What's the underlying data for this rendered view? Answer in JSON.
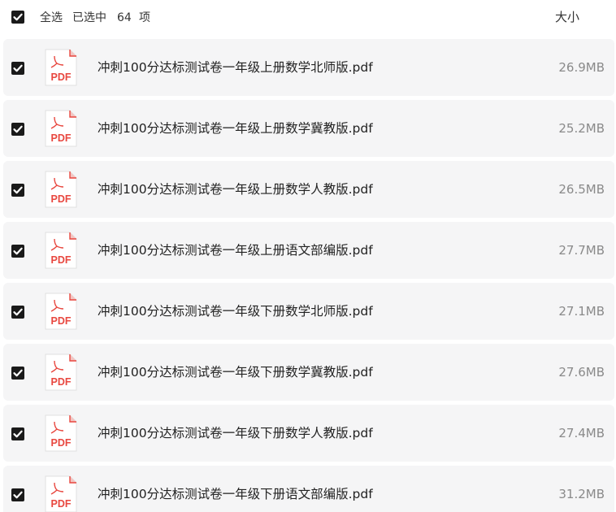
{
  "header": {
    "select_all_label": "全选",
    "selected_prefix": "已选中",
    "selected_count": "64",
    "selected_suffix": "项",
    "size_column_label": "大小"
  },
  "colors": {
    "checkbox": "#1a1a1a",
    "row_background": "#f5f5f6",
    "pdf_icon_accent": "#e8473f",
    "size_text": "#8a8a8a"
  },
  "files": [
    {
      "name": "冲刺100分达标测试卷一年级上册数学北师版.pdf",
      "size": "26.9MB",
      "icon": "pdf-file-icon",
      "checked": true
    },
    {
      "name": "冲刺100分达标测试卷一年级上册数学冀教版.pdf",
      "size": "25.2MB",
      "icon": "pdf-file-icon",
      "checked": true
    },
    {
      "name": "冲刺100分达标测试卷一年级上册数学人教版.pdf",
      "size": "26.5MB",
      "icon": "pdf-file-icon",
      "checked": true
    },
    {
      "name": "冲刺100分达标测试卷一年级上册语文部编版.pdf",
      "size": "27.7MB",
      "icon": "pdf-file-icon",
      "checked": true
    },
    {
      "name": "冲刺100分达标测试卷一年级下册数学北师版.pdf",
      "size": "27.1MB",
      "icon": "pdf-file-icon",
      "checked": true
    },
    {
      "name": "冲刺100分达标测试卷一年级下册数学冀教版.pdf",
      "size": "27.6MB",
      "icon": "pdf-file-icon",
      "checked": true
    },
    {
      "name": "冲刺100分达标测试卷一年级下册数学人教版.pdf",
      "size": "27.4MB",
      "icon": "pdf-file-icon",
      "checked": true
    },
    {
      "name": "冲刺100分达标测试卷一年级下册语文部编版.pdf",
      "size": "31.2MB",
      "icon": "pdf-file-icon",
      "checked": true
    }
  ],
  "pdf_icon_text": "PDF"
}
